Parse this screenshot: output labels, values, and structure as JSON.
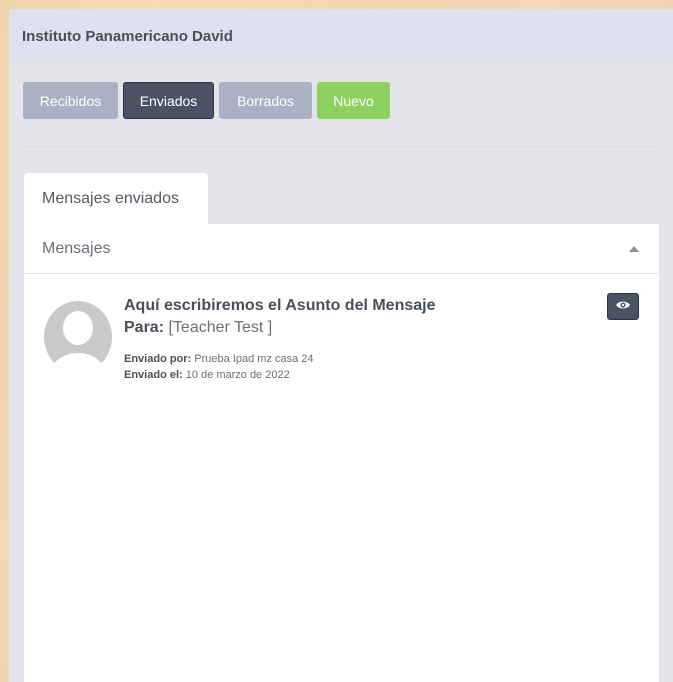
{
  "header": {
    "title": "Instituto Panamericano David"
  },
  "toolbar": {
    "recibidos_label": "Recibidos",
    "enviados_label": "Enviados",
    "borrados_label": "Borrados",
    "nuevo_label": "Nuevo"
  },
  "tab": {
    "label": "Mensajes enviados"
  },
  "card": {
    "title": "Mensajes"
  },
  "message": {
    "subject": "Aquí escribiremos el Asunto del Mensaje",
    "to_label": "Para:",
    "to_value": " [Teacher Test ]",
    "sent_by_label": "Enviado por:",
    "sent_by_value": " Prueba Ipad mz casa 24",
    "sent_on_label": "Enviado el:",
    "sent_on_value": " 10 de marzo de 2022"
  },
  "icons": {
    "avatar": "user-avatar-icon",
    "view": "eye-icon",
    "collapse": "caret-up-icon"
  },
  "colors": {
    "primary_dark": "#4a5263",
    "muted_button": "#aab1c4",
    "success": "#8fd160"
  }
}
